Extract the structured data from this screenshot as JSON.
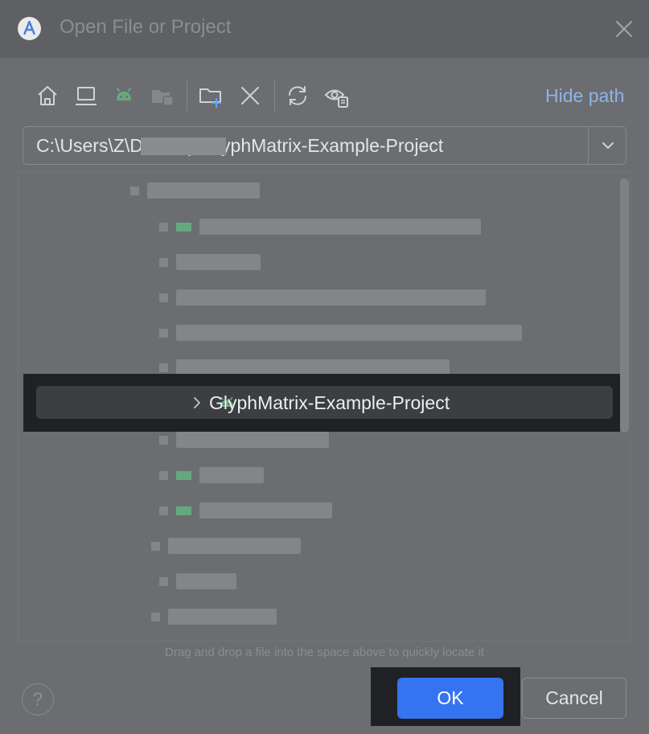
{
  "dialog": {
    "title": "Open File or Project",
    "app_logo_icon": "android-studio-logo-icon",
    "close_icon": "close-icon"
  },
  "toolbar": {
    "icons": [
      "home-icon",
      "desktop-icon",
      "android-icon",
      "folder-icon",
      "new-folder-icon",
      "delete-icon",
      "refresh-icon",
      "show-hidden-icon"
    ],
    "hide_path_label": "Hide path"
  },
  "path": {
    "value": "C:\\Users\\Z\\Desktop\\GlyphMatrix-Example-Project",
    "dropdown_icon": "chevron-down-icon"
  },
  "tree": {
    "selected_item": {
      "label": "GlyphMatrix-Example-Project",
      "expand_icon": "chevron-right-icon",
      "type_icon": "android-icon"
    }
  },
  "hint_text": "Drag and drop a file into the space above to quickly locate it",
  "footer": {
    "help_label": "?",
    "ok_label": "OK",
    "cancel_label": "Cancel"
  },
  "colors": {
    "accent": "#3574f0",
    "link": "#8fb3ea",
    "android_green": "#66a87d",
    "selection_row": "#3c3e42"
  }
}
